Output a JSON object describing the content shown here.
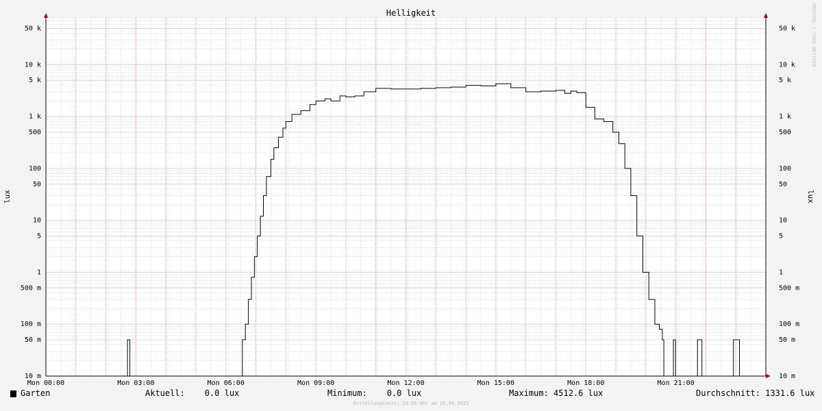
{
  "chart_data": {
    "type": "line",
    "title": "Helligkeit",
    "ylabel": "lux",
    "yscale": "log",
    "ylim": [
      0.01,
      80000
    ],
    "x_ticks": [
      "Mon 00:00",
      "Mon 03:00",
      "Mon 06:00",
      "Mon 09:00",
      "Mon 12:00",
      "Mon 15:00",
      "Mon 18:00",
      "Mon 21:00"
    ],
    "y_ticks": [
      {
        "value": 0.01,
        "label": "10 m"
      },
      {
        "value": 0.05,
        "label": "50 m"
      },
      {
        "value": 0.1,
        "label": "100 m"
      },
      {
        "value": 0.5,
        "label": "500 m"
      },
      {
        "value": 1,
        "label": "1"
      },
      {
        "value": 5,
        "label": "5"
      },
      {
        "value": 10,
        "label": "10"
      },
      {
        "value": 50,
        "label": "50"
      },
      {
        "value": 100,
        "label": "100"
      },
      {
        "value": 500,
        "label": "500"
      },
      {
        "value": 1000,
        "label": "1 k"
      },
      {
        "value": 5000,
        "label": "5 k"
      },
      {
        "value": 10000,
        "label": "10 k"
      },
      {
        "value": 50000,
        "label": "50 k"
      }
    ],
    "grid": true,
    "series": [
      {
        "name": "Garten",
        "color": "#000000",
        "x_hours": [
          0,
          2.7,
          2.72,
          2.78,
          2.8,
          6.5,
          6.55,
          6.65,
          6.75,
          6.85,
          6.95,
          7.05,
          7.15,
          7.25,
          7.35,
          7.5,
          7.6,
          7.75,
          7.9,
          8.0,
          8.2,
          8.5,
          8.8,
          9.0,
          9.3,
          9.5,
          9.8,
          10.0,
          10.3,
          10.6,
          11.0,
          11.5,
          12.0,
          12.5,
          13.0,
          13.5,
          14.0,
          14.5,
          15.0,
          15.5,
          16.0,
          16.5,
          17.0,
          17.3,
          17.5,
          17.7,
          18.0,
          18.3,
          18.6,
          18.9,
          19.1,
          19.3,
          19.5,
          19.7,
          19.9,
          20.1,
          20.3,
          20.45,
          20.55,
          20.6,
          20.62,
          20.9,
          20.92,
          20.97,
          20.99,
          21.7,
          21.72,
          21.85,
          21.87,
          22.9,
          22.92,
          23.1,
          23.12,
          24.0
        ],
        "values": [
          0.01,
          0.01,
          0.05,
          0.05,
          0.01,
          0.01,
          0.05,
          0.1,
          0.3,
          0.8,
          2,
          5,
          12,
          30,
          70,
          150,
          250,
          400,
          600,
          800,
          1100,
          1300,
          1700,
          2000,
          2200,
          2000,
          2500,
          2400,
          2500,
          3000,
          3500,
          3400,
          3400,
          3500,
          3600,
          3700,
          4000,
          3900,
          4300,
          3600,
          3000,
          3100,
          3200,
          2800,
          3100,
          2900,
          1500,
          900,
          800,
          500,
          300,
          100,
          30,
          5,
          1,
          0.3,
          0.1,
          0.08,
          0.05,
          0.01,
          0.01,
          0.01,
          0.05,
          0.05,
          0.01,
          0.01,
          0.05,
          0.05,
          0.01,
          0.01,
          0.05,
          0.05,
          0.01,
          0.01
        ]
      }
    ]
  },
  "legend": {
    "series_name": "Garten",
    "current": "Aktuell:    0.0 lux",
    "minimum": "Minimum:    0.0 lux",
    "maximum": "Maximum: 4512.6 lux",
    "average": "Durchschnitt: 1331.6 lux"
  },
  "footer": "Erstellungszeit: 23:55 Uhr am 25.09.2023",
  "watermark": "RRDTOOL / TOBI OETIKER"
}
